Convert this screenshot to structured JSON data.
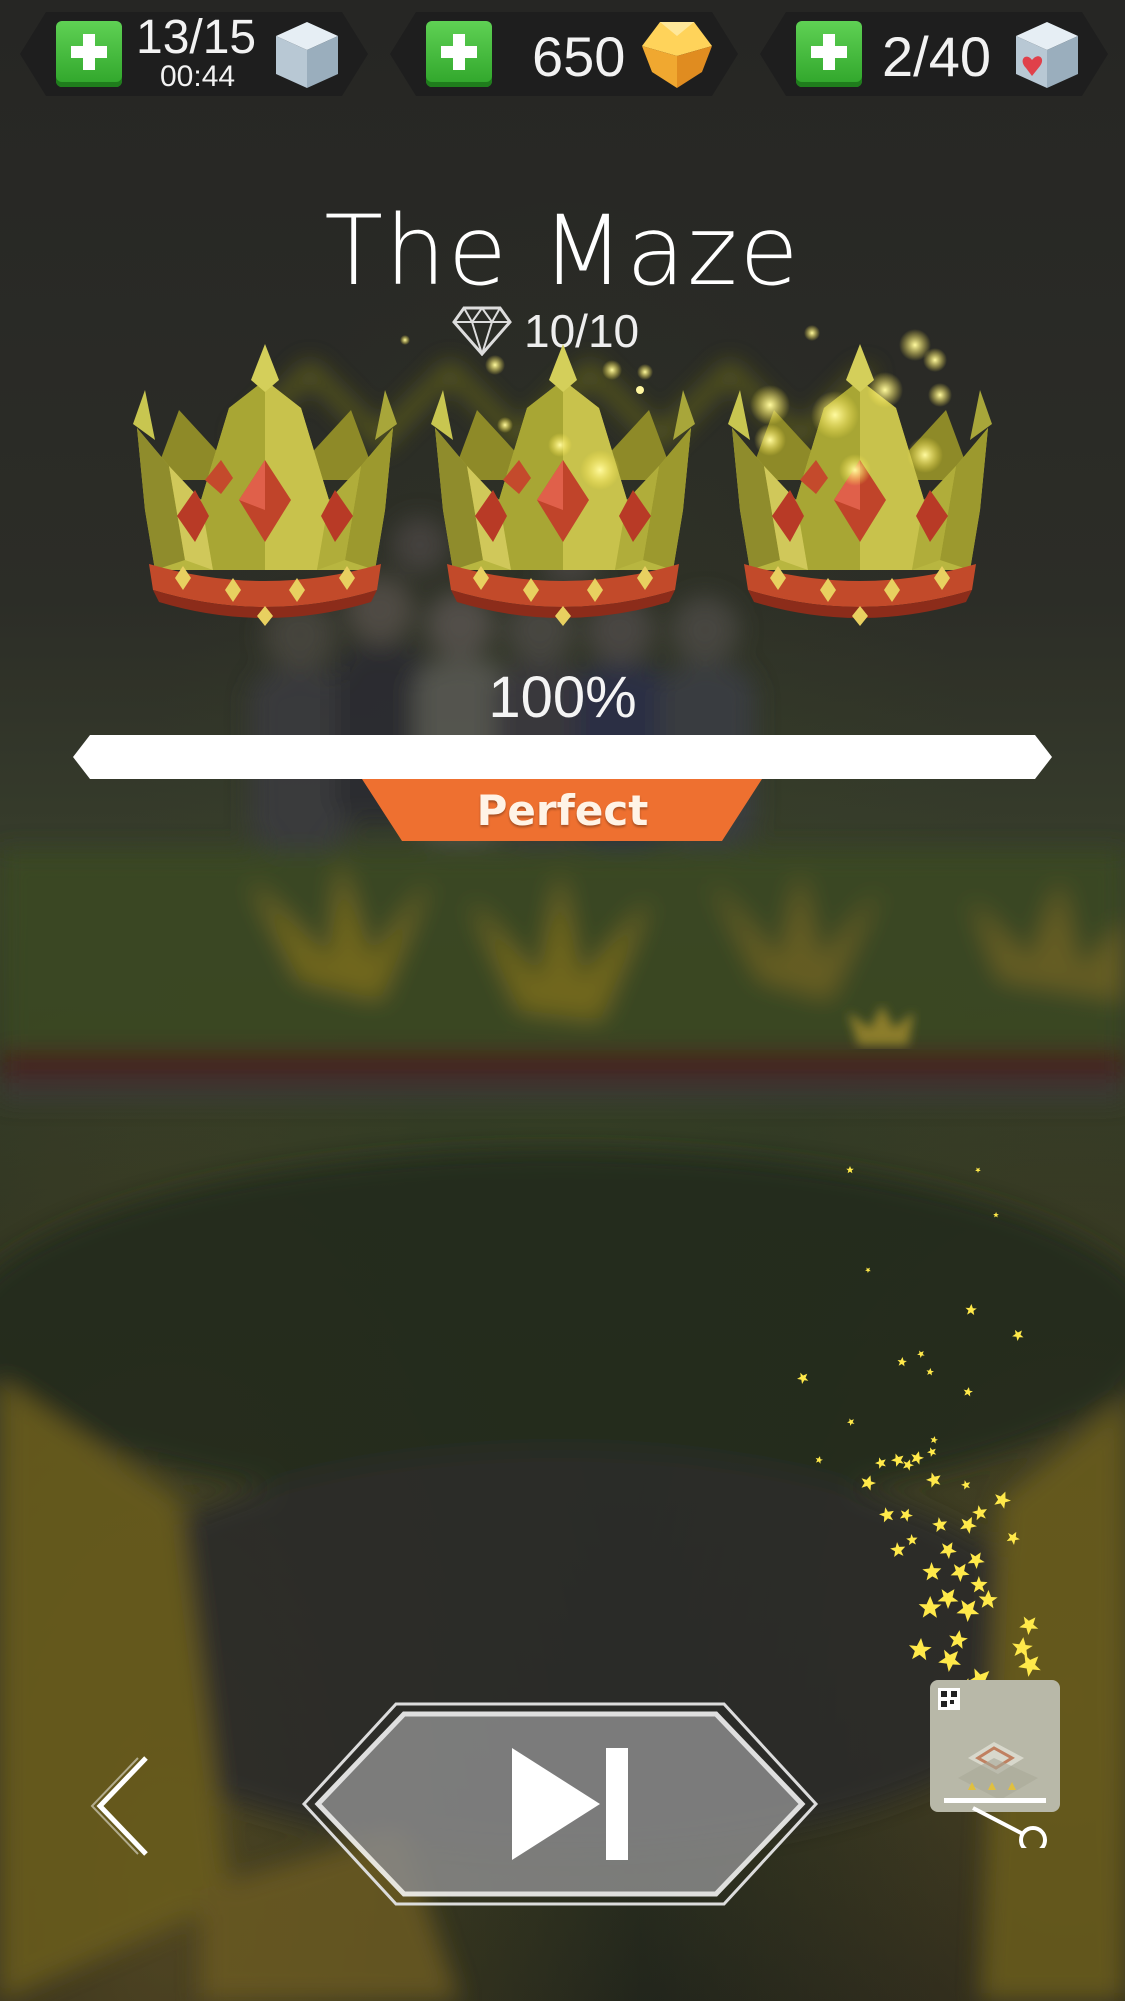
{
  "hud": {
    "lives": {
      "count": "13/15",
      "timer": "00:44",
      "icon": "ice-cube-icon"
    },
    "gems": {
      "count": "650",
      "icon": "gold-gem-icon"
    },
    "hearts": {
      "count": "2/40",
      "icon": "heart-cube-icon"
    },
    "plus_icon": "plus-icon"
  },
  "level": {
    "title": "The Maze",
    "gems": "10/10",
    "percent": "100%",
    "percent_value": 100,
    "rating": "Perfect",
    "crowns_earned": 3
  },
  "controls": {
    "back_icon": "chevron-left-icon",
    "next_icon": "skip-next-icon",
    "share_icon": "share-icon"
  },
  "colors": {
    "accent_orange": "#ee7030",
    "plus_green": "#3fbf39",
    "crown_gold": "#c8c050",
    "crown_red": "#c24a2a"
  }
}
